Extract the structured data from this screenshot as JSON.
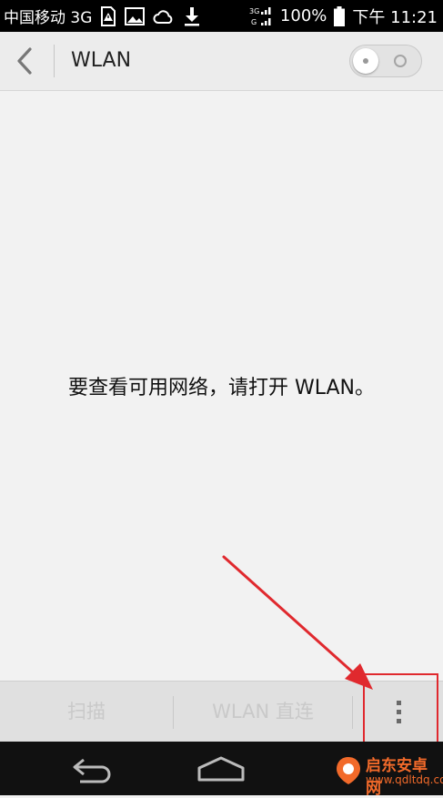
{
  "status_bar": {
    "carrier": "中国移动 3G",
    "signal_badge_top": "3G",
    "signal_badge_bottom": "G",
    "battery_percent": "100%",
    "time": "下午 11:21"
  },
  "app_bar": {
    "title": "WLAN",
    "wlan_switch_on": false
  },
  "main": {
    "message": "要查看可用网络，请打开 WLAN。"
  },
  "bottom_bar": {
    "scan_label": "扫描",
    "wifi_direct_label": "WLAN 直连"
  },
  "watermark": {
    "name": "启东安卓网",
    "url": "www.qdltdq.com"
  },
  "colors": {
    "annotation_red": "#e0292e",
    "watermark_orange": "#f26a2a"
  }
}
